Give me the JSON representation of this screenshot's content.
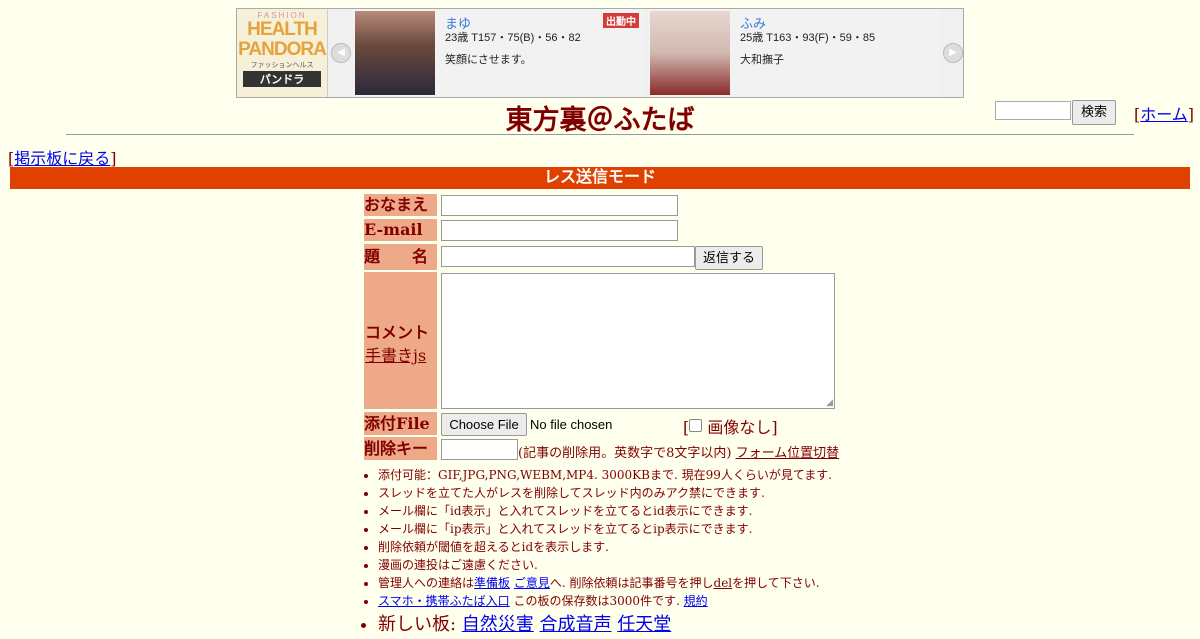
{
  "ad": {
    "logo": {
      "fashion": "FASHION",
      "line1": "HEALTH",
      "line2": "PANDORA",
      "sub": "ファッションヘルス",
      "jp": "パンドラ"
    },
    "cards": [
      {
        "name": "まゆ",
        "stats": "23歳 T157・75(B)・56・82",
        "caption": "笑顔にさせます。",
        "badge": "出勤中"
      },
      {
        "name": "ふみ",
        "stats": "25歳 T163・93(F)・59・85",
        "caption": "大和撫子",
        "badge": ""
      }
    ],
    "colors": {
      "photo1": "#8a6a5a",
      "photo2": "#d9c5c0"
    }
  },
  "header": {
    "title": "東方裏＠ふたば",
    "search_button": "検索",
    "home_link": "ホーム"
  },
  "back_link": "掲示板に戻る",
  "mode_bar": "レス送信モード",
  "form": {
    "name_label": "おなまえ",
    "email_label": "E-mail",
    "subject_label": "題　　名",
    "submit_button": "返信する",
    "comment_label": "コメント",
    "handwrite_link": "手書きjs",
    "file_label": "添付File",
    "choose_file": "Choose File",
    "no_file": "No file chosen",
    "no_image": "画像なし",
    "delkey_label": "削除キー",
    "delkey_note": "(記事の削除用。英数字で8文字以内)",
    "form_toggle": "フォーム位置切替"
  },
  "rules": {
    "r1": "添付可能：GIF,JPG,PNG,WEBM,MP4. 3000KBまで. 現在99人くらいが見てます.",
    "r2": "スレッドを立てた人がレスを削除してスレッド内のみアク禁にできます.",
    "r3": "メール欄に「id表示」と入れてスレッドを立てるとid表示にできます.",
    "r4": "メール欄に「ip表示」と入れてスレッドを立てるとip表示にできます.",
    "r5": "削除依頼が閾値を超えるとidを表示します.",
    "r6": "漫画の連投はご遠慮ください.",
    "r7_pre": "管理人への連絡は",
    "r7_link1": "準備板",
    "r7_link2": "ご意見",
    "r7_mid": "へ. 削除依頼は記事番号を押し",
    "r7_del": "del",
    "r7_post": "を押して下さい.",
    "r8_link": "スマホ・携帯ふたば入口",
    "r8_mid": " この板の保存数は3000件です. ",
    "r8_terms": "規約",
    "r9_pre": "新しい板: ",
    "r9_links": [
      "自然災害",
      "合成音声",
      "任天堂"
    ]
  }
}
